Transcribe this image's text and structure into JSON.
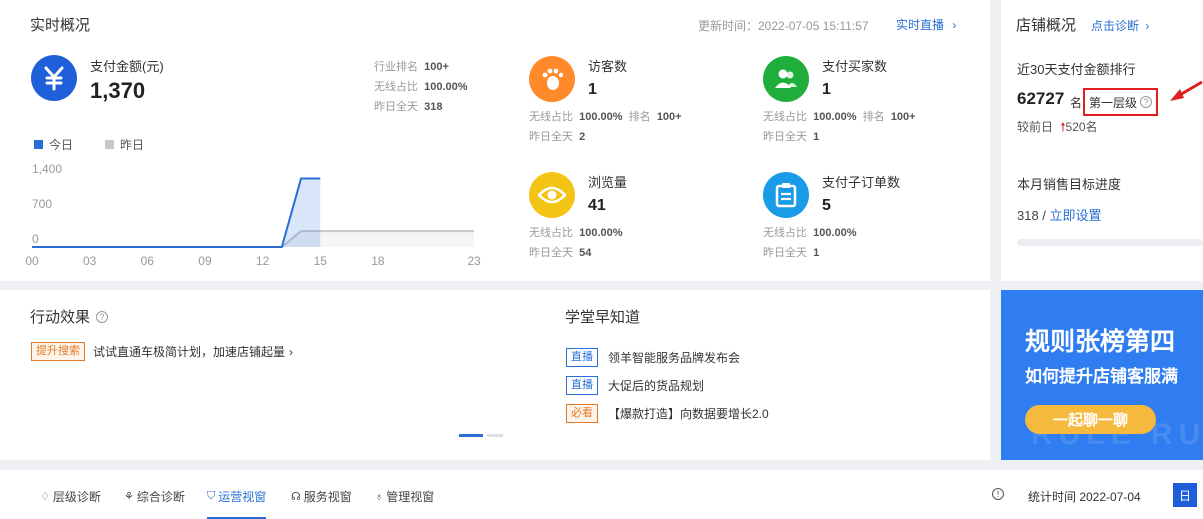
{
  "realtime": {
    "title": "实时概况",
    "update_time": "更新时间：2022-07-05 15:11:57",
    "live_link": "实时直播",
    "pay": {
      "label": "支付金额(元)",
      "value": "1,370",
      "rank_label": "行业排名",
      "rank_value": "100+",
      "wireless_label": "无线占比",
      "wireless_value": "100.00%",
      "yesterday_label": "昨日全天",
      "yesterday_value": "318"
    },
    "legend": {
      "today": "今日",
      "yesterday": "昨日"
    },
    "metrics": [
      {
        "label": "访客数",
        "value": "1",
        "line1_label": "无线占比",
        "line1_value": "100.00%",
        "rank_label": "排名",
        "rank_value": "100+",
        "line2_label": "昨日全天",
        "line2_value": "2",
        "icon": "footprint-icon",
        "color": "#ff8a2a"
      },
      {
        "label": "支付买家数",
        "value": "1",
        "line1_label": "无线占比",
        "line1_value": "100.00%",
        "rank_label": "排名",
        "rank_value": "100+",
        "line2_label": "昨日全天",
        "line2_value": "1",
        "icon": "users-icon",
        "color": "#1fae3c"
      },
      {
        "label": "浏览量",
        "value": "41",
        "line1_label": "无线占比",
        "line1_value": "100.00%",
        "line2_label": "昨日全天",
        "line2_value": "54",
        "icon": "eye-icon",
        "color": "#f3c416"
      },
      {
        "label": "支付子订单数",
        "value": "5",
        "line1_label": "无线占比",
        "line1_value": "100.00%",
        "line2_label": "昨日全天",
        "line2_value": "1",
        "icon": "clipboard-icon",
        "color": "#1a9be8"
      }
    ]
  },
  "chart_data": {
    "type": "area",
    "x_ticks": [
      "00",
      "03",
      "06",
      "09",
      "12",
      "15",
      "18",
      "23"
    ],
    "y_ticks": [
      "1,400",
      "700",
      "0"
    ],
    "ylim": [
      0,
      1400
    ],
    "xlim": [
      0,
      23
    ],
    "series": [
      {
        "name": "今日",
        "color": "#2a6fd6",
        "points": [
          [
            0,
            0
          ],
          [
            13,
            0
          ],
          [
            14,
            1370
          ],
          [
            15,
            1370
          ]
        ]
      },
      {
        "name": "昨日",
        "color": "#c8c8c8",
        "points": [
          [
            0,
            0
          ],
          [
            13,
            0
          ],
          [
            14,
            318
          ],
          [
            23,
            318
          ]
        ]
      }
    ]
  },
  "store": {
    "title": "店铺概况",
    "diagnose_link": "点击诊断",
    "rank_title": "近30天支付金额排行",
    "rank_value": "62727",
    "rank_unit": "名",
    "level": "第一层级",
    "compare_label": "较前日",
    "compare_value": "520名",
    "target_title": "本月销售目标进度",
    "target_value": "318 /",
    "target_link": "立即设置"
  },
  "action": {
    "title": "行动效果",
    "tag": "提升搜索",
    "text": "试试直通车极简计划，加速店铺起量"
  },
  "learn": {
    "title": "学堂早知道",
    "items": [
      {
        "tag": "直播",
        "tag_style": "blue",
        "text": "领羊智能服务品牌发布会"
      },
      {
        "tag": "直播",
        "tag_style": "blue",
        "text": "大促后的货品规划"
      },
      {
        "tag": "必看",
        "tag_style": "orange",
        "text": "【爆款打造】向数据要增长2.0"
      }
    ]
  },
  "banner": {
    "headline": "规则张榜第四",
    "sub": "如何提升店铺客服满",
    "button": "一起聊一聊",
    "watermark": "RULE RU"
  },
  "tabs": [
    {
      "label": "层级诊断",
      "icon": "diamond-icon"
    },
    {
      "label": "综合诊断",
      "icon": "badge-icon"
    },
    {
      "label": "运营视窗",
      "icon": "shield-icon",
      "active": true
    },
    {
      "label": "服务视窗",
      "icon": "headset-icon"
    },
    {
      "label": "管理视窗",
      "icon": "person-icon"
    }
  ],
  "footer": {
    "stat_time": "统计时间 2022-07-04",
    "day_button": "日"
  }
}
